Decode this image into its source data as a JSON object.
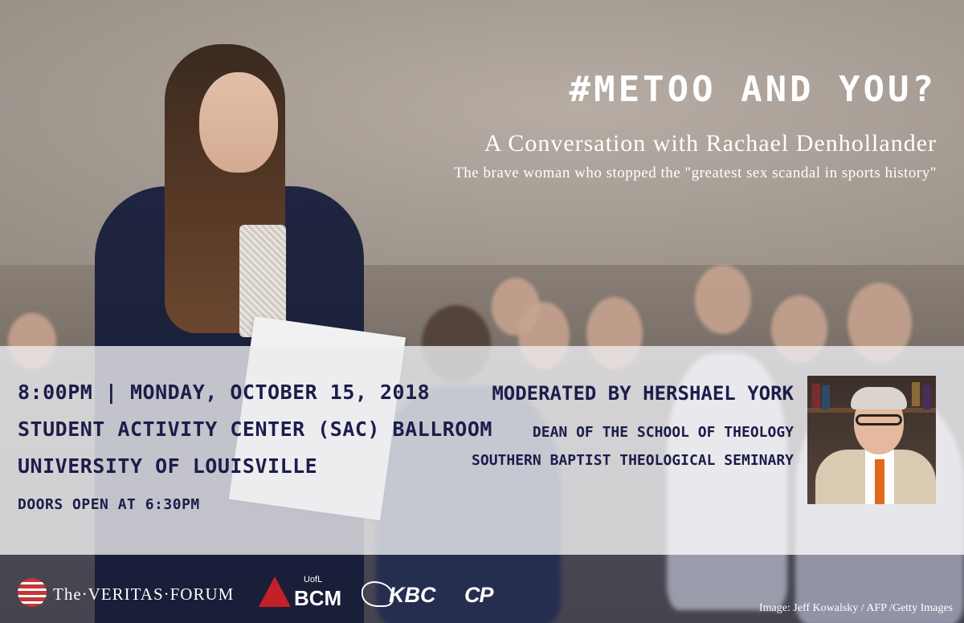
{
  "title": "#METOO AND YOU?",
  "subtitle": "A Conversation with Rachael Denhollander",
  "tagline": "The brave woman who stopped the \"greatest sex scandal in sports history\"",
  "event": {
    "datetime": "8:00PM | MONDAY, OCTOBER 15, 2018",
    "venue": "STUDENT ACTIVITY CENTER (SAC) BALLROOM",
    "institution": "UNIVERSITY OF LOUISVILLE",
    "doors": "DOORS OPEN AT 6:30PM"
  },
  "moderator": {
    "heading": "MODERATED BY HERSHAEL YORK",
    "role": "DEAN OF THE SCHOOL OF THEOLOGY",
    "organization": "SOUTHERN BAPTIST THEOLOGICAL SEMINARY"
  },
  "sponsors": {
    "veritas": "The·VERITAS·FORUM",
    "bcm_small": "UofL",
    "bcm": "BCM",
    "kbc": "KBC",
    "cp": "CP"
  },
  "credit": "Image: Jeff Kowalsky / AFP /Getty Images",
  "colors": {
    "navy_text": "#1b1d4a",
    "band": "#ececf0",
    "brand_red": "#c32127",
    "white": "#ffffff"
  }
}
